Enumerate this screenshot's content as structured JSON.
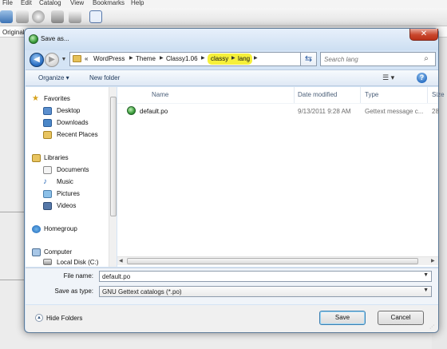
{
  "background_app": {
    "menu": [
      "File",
      "Edit",
      "Catalog",
      "View",
      "Bookmarks",
      "Help"
    ],
    "column_header": "Original"
  },
  "dialog": {
    "title": "Save as...",
    "close_glyph": "✕",
    "breadcrumbs": [
      "«",
      "WordPress",
      "Theme",
      "Classy1.06",
      "classy",
      "lang"
    ],
    "search_placeholder": "Search lang",
    "organize_label": "Organize ▾",
    "new_folder_label": "New folder",
    "help_glyph": "?",
    "nav": {
      "favorites": "Favorites",
      "desktop": "Desktop",
      "downloads": "Downloads",
      "recent_places": "Recent Places",
      "libraries": "Libraries",
      "documents": "Documents",
      "music": "Music",
      "pictures": "Pictures",
      "videos": "Videos",
      "homegroup": "Homegroup",
      "computer": "Computer",
      "local_disk": "Local Disk (C:)"
    },
    "columns": {
      "name": "Name",
      "date_modified": "Date modified",
      "type": "Type",
      "size": "Size"
    },
    "files": [
      {
        "name": "default.po",
        "date": "9/13/2011 9:28 AM",
        "type": "Gettext message c...",
        "size": "28"
      }
    ],
    "file_name_label": "File name:",
    "file_name_value": "default.po",
    "save_type_label": "Save as type:",
    "save_type_value": "GNU Gettext catalogs (*.po)",
    "hide_folders_label": "Hide Folders",
    "save_button": "Save",
    "cancel_button": "Cancel"
  }
}
